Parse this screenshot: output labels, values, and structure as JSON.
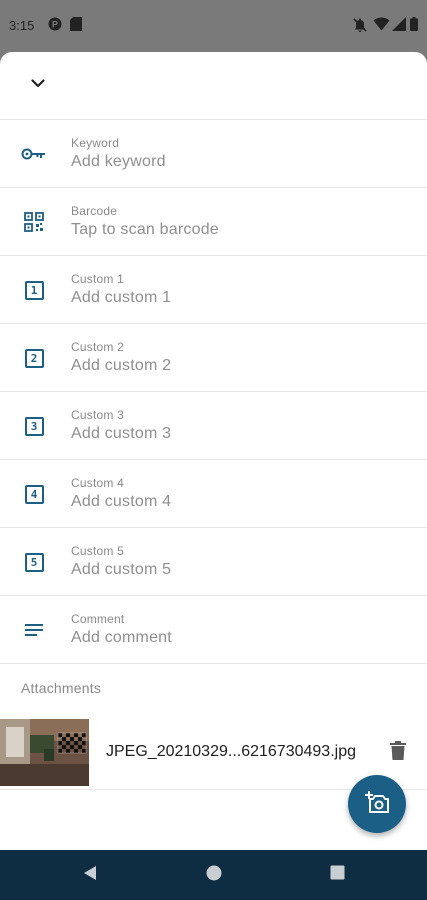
{
  "status_bar": {
    "time": "3:15"
  },
  "fields": [
    {
      "label": "Keyword",
      "value": "Add keyword",
      "icon": "key-icon"
    },
    {
      "label": "Barcode",
      "value": "Tap to scan barcode",
      "icon": "qr-code-icon"
    },
    {
      "label": "Custom 1",
      "value": "Add custom 1",
      "icon": "number-1-icon",
      "num": "1"
    },
    {
      "label": "Custom 2",
      "value": "Add custom 2",
      "icon": "number-2-icon",
      "num": "2"
    },
    {
      "label": "Custom 3",
      "value": "Add custom 3",
      "icon": "number-3-icon",
      "num": "3"
    },
    {
      "label": "Custom 4",
      "value": "Add custom 4",
      "icon": "number-4-icon",
      "num": "4"
    },
    {
      "label": "Custom 5",
      "value": "Add custom 5",
      "icon": "number-5-icon",
      "num": "5"
    },
    {
      "label": "Comment",
      "value": "Add comment",
      "icon": "comment-lines-icon"
    }
  ],
  "attachments": {
    "title": "Attachments",
    "items": [
      {
        "name": "JPEG_20210329...6216730493.jpg"
      }
    ]
  },
  "colors": {
    "accent": "#1c5f86",
    "nav_bar": "#0f2d42",
    "status_bar": "#7a7a7a"
  }
}
